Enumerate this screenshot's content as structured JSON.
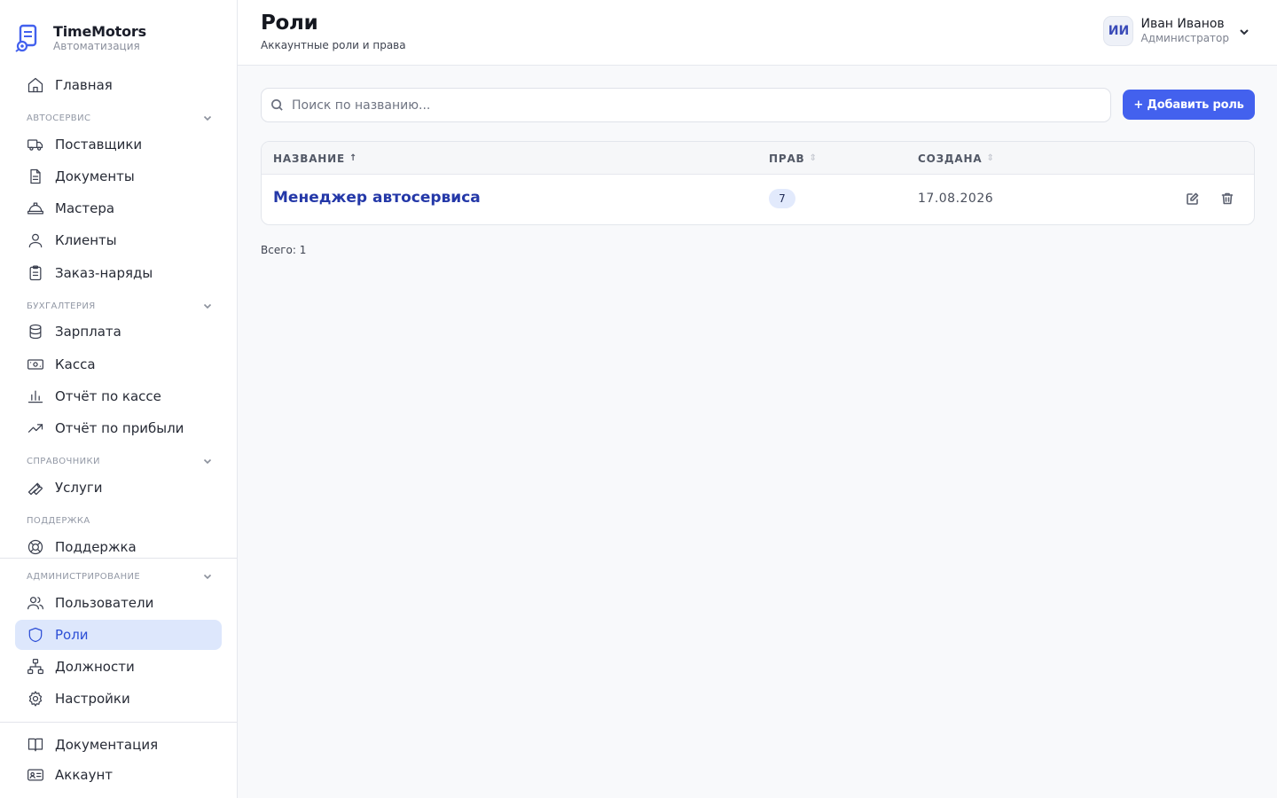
{
  "brand": {
    "title": "TimeMotors",
    "subtitle": "Автоматизация"
  },
  "sidebar": {
    "home": "Главная",
    "sections": {
      "autoservice": "Автосервис",
      "accounting": "Бухгалтерия",
      "directories": "Справочники",
      "support": "Поддержка",
      "admin": "Администрирование"
    },
    "items": {
      "suppliers": "Поставщики",
      "documents": "Документы",
      "masters": "Мастера",
      "clients": "Клиенты",
      "orders": "Заказ-наряды",
      "salary": "Зарплата",
      "cash": "Касса",
      "cash_report": "Отчёт по кассе",
      "profit_report": "Отчёт по прибыли",
      "services": "Услуги",
      "support": "Поддержка",
      "users": "Пользователи",
      "roles": "Роли",
      "positions": "Должности",
      "settings": "Настройки",
      "docs": "Документация",
      "account": "Аккаунт"
    },
    "active_item": "roles"
  },
  "header": {
    "title": "Роли",
    "subtitle": "Аккаунтные роли и права",
    "user": {
      "initials": "ИИ",
      "name": "Иван Иванов",
      "role": "Администратор"
    }
  },
  "toolbar": {
    "search_placeholder": "Поиск по названию...",
    "add_label": "+ Добавить роль"
  },
  "table": {
    "columns": {
      "name": "Название",
      "name_sort": "↑",
      "rights": "Прав",
      "rights_sort": "⇕",
      "created": "Создана",
      "created_sort": "⇕"
    },
    "rows": [
      {
        "name": "Менеджер автосервиса",
        "rights": "7",
        "created": "17.08.2026"
      }
    ]
  },
  "footer": {
    "total": "Всего: 1"
  },
  "colors": {
    "accent": "#4361ee",
    "active_bg": "#dde7fc",
    "link": "#2438a8"
  }
}
